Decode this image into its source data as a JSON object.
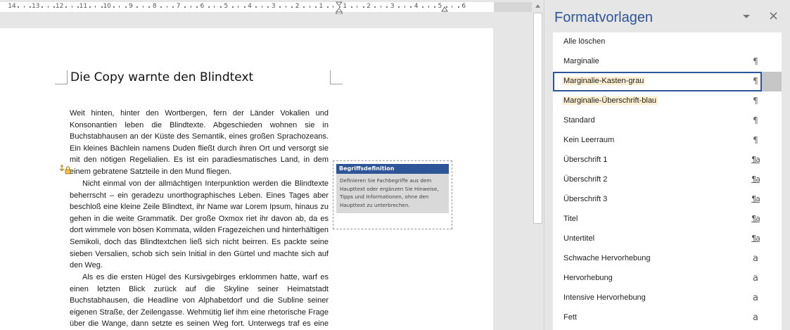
{
  "ruler": {
    "labels": [
      "14",
      "13",
      "12",
      "11",
      "10",
      "9",
      "8",
      "7",
      "6",
      "5",
      "4",
      "3",
      "2",
      "1",
      "1",
      "2",
      "3",
      "4",
      "5",
      "6"
    ]
  },
  "document": {
    "title": "Die Copy warnte den Blindtext",
    "paragraphs": [
      "Weit hinten, hinter den Wortbergen, fern der Länder Vokalien und Konsonantien leben die Blindtexte. Abgeschieden wohnen sie in Buchstabhausen an der Küste des Semantik, eines großen Sprachozeans. Ein kleines Bächlein namens Duden fließt durch ihren Ort und versorgt sie mit den nötigen Regelialien. Es ist ein paradiesmatisches Land, in dem einem gebratene Satzteile in den Mund fliegen.",
      "Nicht einmal von der allmächtigen Interpunktion werden die Blindtexte beherrscht – ein geradezu unorthographisches Leben. Eines Tages aber beschloß eine kleine Zeile Blindtext, ihr Name war Lorem Ipsum, hinaus zu gehen in die weite Grammatik. Der große Oxmox riet ihr davon ab, da es dort wimmele von bösen Kommata, wilden Fragezeichen und hinterhältigen Semikoli, doch das Blindtextchen ließ sich nicht beirren. Es packte seine sieben Versalien, schob sich sein Initial in den Gürtel und machte sich auf den Weg.",
      "Als es die ersten Hügel des Kursivgebirges erklommen hatte, warf es einen letzten Blick zurück auf die Skyline seiner Heimatstadt Buchstabhausen, die Headline von Alphabetdorf und die Subline seiner eigenen Straße, der Zeilengasse. Wehmütig lief ihm eine rhetorische Frage über die Wange, dann setzte es seinen Weg fort. Unterwegs traf es eine Copy."
    ],
    "sidebox": {
      "heading": "Begriffsdefinition",
      "body": "Definieren Sie Fachbegriffe aus dem Haupttext oder ergänzen Sie Hinweise, Tipps und Informationen, ohne den Haupttext zu unterbrechen."
    }
  },
  "styles_pane": {
    "title": "Formatvorlagen",
    "dropdown_icon": "chevron-down-icon",
    "close_icon": "close-icon",
    "items": [
      {
        "label": "Alle löschen",
        "glyph": ""
      },
      {
        "label": "Marginalie",
        "glyph": "¶"
      },
      {
        "label": "Marginalie-Kasten-grau",
        "glyph": "¶"
      },
      {
        "label": "Marginalie-Überschrift-blau",
        "glyph": "¶"
      },
      {
        "label": "Standard",
        "glyph": "¶"
      },
      {
        "label": "Kein Leerraum",
        "glyph": "¶"
      },
      {
        "label": "Überschrift 1",
        "glyph": "¶a"
      },
      {
        "label": "Überschrift 2",
        "glyph": "¶a"
      },
      {
        "label": "Überschrift 3",
        "glyph": "¶a"
      },
      {
        "label": "Titel",
        "glyph": "¶a"
      },
      {
        "label": "Untertitel",
        "glyph": "¶a"
      },
      {
        "label": "Schwache Hervorhebung",
        "glyph": "a"
      },
      {
        "label": "Hervorhebung",
        "glyph": "a"
      },
      {
        "label": "Intensive Hervorhebung",
        "glyph": "a"
      },
      {
        "label": "Fett",
        "glyph": "a"
      }
    ]
  },
  "colors": {
    "accent": "#2e5597",
    "highlight": "#fcefd2"
  }
}
